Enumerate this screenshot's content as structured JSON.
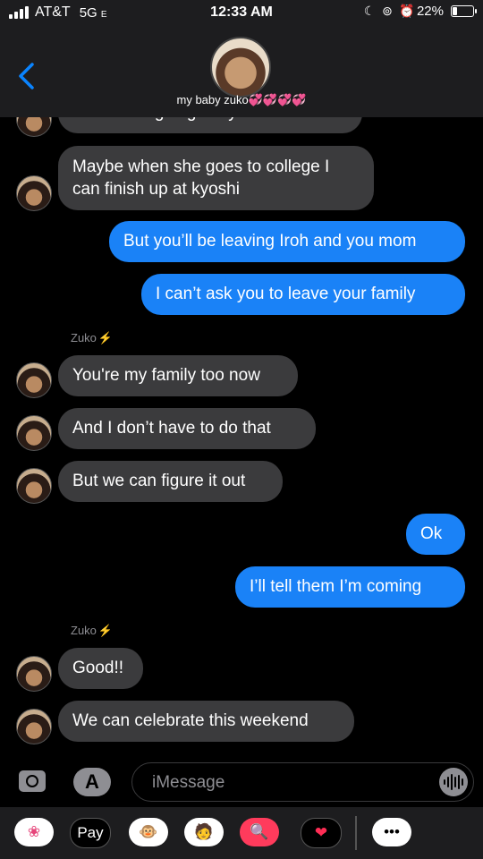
{
  "status_bar": {
    "carrier": "AT&T",
    "network": "5G",
    "network_suffix": "E",
    "time": "12:33 AM",
    "battery": "22%",
    "battery_level": 0.22
  },
  "header": {
    "contact_name": "my baby zuko💞💞💞💞"
  },
  "messages": [
    {
      "dir": "in",
      "text": "suki about going to kyoshi"
    },
    {
      "dir": "in",
      "text": "Maybe when she goes to college I"
    },
    {
      "dir": "in",
      "text": "can finish up at kyoshi"
    },
    {
      "dir": "out",
      "text": "But you’ll be leaving Iroh and you mom"
    },
    {
      "dir": "out",
      "text": "I can’t ask you to leave your family"
    },
    {
      "dir": "label",
      "text": "Zuko"
    },
    {
      "dir": "in",
      "text": "You're my family too now"
    },
    {
      "dir": "in",
      "text": "And I don’t have to do that"
    },
    {
      "dir": "in",
      "text": "But we can figure it out"
    },
    {
      "dir": "out",
      "text": "Ok"
    },
    {
      "dir": "out",
      "text": "I’ll tell them I’m coming"
    },
    {
      "dir": "label",
      "text": "Zuko"
    },
    {
      "dir": "in",
      "text": "Good!!"
    },
    {
      "dir": "in",
      "text": "We can celebrate this weekend"
    }
  ],
  "sender_bolt": "⚡",
  "input": {
    "placeholder": "iMessage",
    "appstore_glyph": "A"
  },
  "app_drawer": [
    {
      "name": "photos-app-icon",
      "glyph": "❀",
      "bg": "#ffffff",
      "color": "#e6457a"
    },
    {
      "name": "apple-pay-app-icon",
      "glyph": "Pay",
      "bg": "#000000",
      "color": "#ffffff"
    },
    {
      "name": "animoji-app-icon",
      "glyph": "🐵",
      "bg": "#ffffff",
      "color": "#000000"
    },
    {
      "name": "memoji-app-icon",
      "glyph": "🧑",
      "bg": "#ffffff",
      "color": "#000000"
    },
    {
      "name": "web-images-app-icon",
      "glyph": "🔍",
      "bg": "#ff3b5c",
      "color": "#ffffff"
    },
    {
      "name": "digital-touch-app-icon",
      "glyph": "❤",
      "bg": "#000000",
      "color": "#ff2d55"
    },
    {
      "name": "more-apps-icon",
      "glyph": "•••",
      "bg": "#ffffff",
      "color": "#000000"
    }
  ],
  "colors": {
    "incoming_bubble": "#3b3b3d",
    "outgoing_bubble": "#1a82f7",
    "accent": "#0a84ff"
  }
}
